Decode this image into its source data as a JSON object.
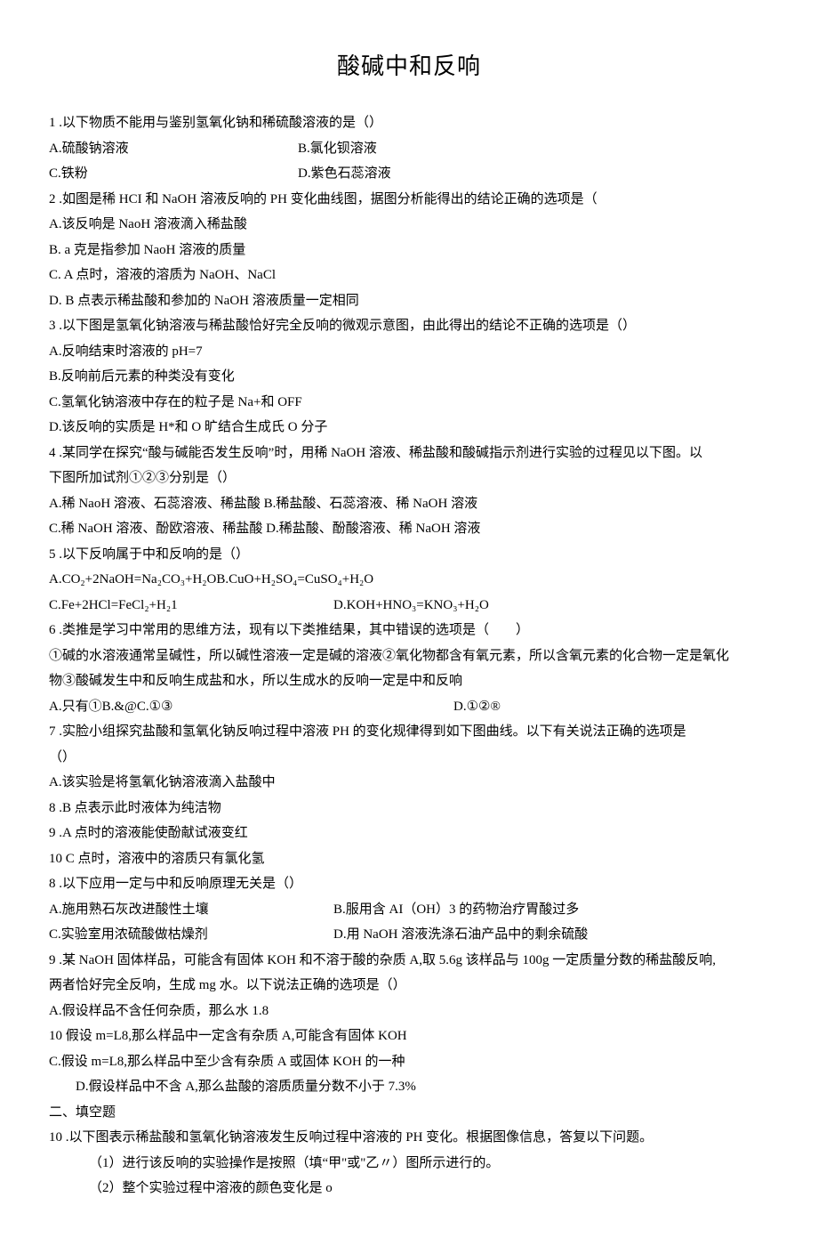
{
  "title": "酸碱中和反响",
  "q1": {
    "stem": "1 .以下物质不能用与鉴别氢氧化钠和稀硫酸溶液的是（）",
    "a": "A.硫酸钠溶液",
    "b": "B.氯化钡溶液",
    "c": "C.铁粉",
    "d": "D.紫色石蕊溶液"
  },
  "q2": {
    "stem": "2 .如图是稀 HCI 和 NaOH 溶液反响的 PH 变化曲线图，据图分析能得出的结论正确的选项是（",
    "a": "A.该反响是 NaoH 溶液滴入稀盐酸",
    "b": "B. a 克是指参加 NaoH 溶液的质量",
    "c": "C. A 点时，溶液的溶质为 NaOH、NaCl",
    "d": "D. B 点表示稀盐酸和参加的 NaOH 溶液质量一定相同"
  },
  "q3": {
    "stem": "3 .以下图是氢氧化钠溶液与稀盐酸恰好完全反响的微观示意图，由此得出的结论不正确的选项是（）",
    "a": "A.反响结束时溶液的 pH=7",
    "b": "B.反响前后元素的种类没有变化",
    "c": "C.氢氧化钠溶液中存在的粒子是 Na+和 OFF",
    "d": "D.该反响的实质是 H*和 O 旷结合生成氏 O 分子"
  },
  "q4": {
    "stem1": "4 .某同学在探究“酸与碱能否发生反响”时，用稀 NaOH 溶液、稀盐酸和酸碱指示剂进行实验的过程见以下图。以",
    "stem2": "下图所加试剂①②③分别是（）",
    "a": "A.稀 NaoH 溶液、石蕊溶液、稀盐酸 B.稀盐酸、石蕊溶液、稀 NaOH 溶液",
    "c": "C.稀 NaOH 溶液、酚欧溶液、稀盐酸 D.稀盐酸、酚酸溶液、稀 NaOH 溶液"
  },
  "q5": {
    "stem": "5 .以下反响属于中和反响的是（）",
    "ab": "A.CO₂+2NaOH=Na₂CO₃+H₂OB.CuO+H₂SO₄=CuSO₄+H₂O",
    "c": "C.Fe+2HCl=FeCl₂+H₂1",
    "d": "D.KOH+HNO₃=KNO₃+H₂O"
  },
  "q6": {
    "stem": "6 .类推是学习中常用的思维方法，现有以下类推结果，其中错误的选项是（　　）",
    "l1": "①碱的水溶液通常呈碱性，所以碱性溶液一定是碱的溶液②氧化物都含有氧元素，所以含氧元素的化合物一定是氧化",
    "l2": "物③酸碱发生中和反响生成盐和水，所以生成水的反响一定是中和反响",
    "a": "A.只有①B.&@C.①③",
    "d": "D.①②®"
  },
  "q7": {
    "stem1": "7 .实脸小组探究盐酸和氢氧化钠反响过程中溶液 PH 的变化规律得到如下图曲线。以下有关说法正确的选项是",
    "stem2": "（）",
    "a": "A.该实验是将氢氧化钠溶液滴入盐酸中",
    "b": "8 .B 点表示此时液体为纯洁物",
    "c": "9 .A 点时的溶液能使酚献试液变红",
    "d": "10 C 点时，溶液中的溶质只有氯化氢"
  },
  "q8": {
    "stem": "8 .以下应用一定与中和反响原理无关是（）",
    "a": "A.施用熟石灰改进酸性土壤",
    "b": "B.服用含 AI（OH）3 的药物治疗胃酸过多",
    "c": "C.实验室用浓硫酸做枯燥剂",
    "d": "D.用 NaOH 溶液洗涤石油产品中的剩余硫酸"
  },
  "q9": {
    "stem1": "9 .某 NaOH 固体样品，可能含有固体 KOH 和不溶于酸的杂质 A,取 5.6g 该样品与 100g 一定质量分数的稀盐酸反响,",
    "stem2": "两者恰好完全反响，生成 mg 水。以下说法正确的选项是（）",
    "a": "A.假设样品不含任何杂质，那么水 1.8",
    "b": "10 假设 m=L8,那么样品中一定含有杂质 A,可能含有固体 KOH",
    "c": "C.假设 m=L8,那么样品中至少含有杂质 A 或固体 KOH 的一种",
    "d": "D.假设样品中不含 A,那么盐酸的溶质质量分数不小于 7.3%"
  },
  "section2": "二、填空题",
  "q10": {
    "stem": "10 .以下图表示稀盐酸和氢氧化钠溶液发生反响过程中溶液的 PH 变化。根据图像信息，答复以下问题。",
    "p1": "（1）进行该反响的实验操作是按照（填“甲\"或\"乙〃）图所示进行的。",
    "p2": "（2）整个实验过程中溶液的颜色变化是 o"
  }
}
